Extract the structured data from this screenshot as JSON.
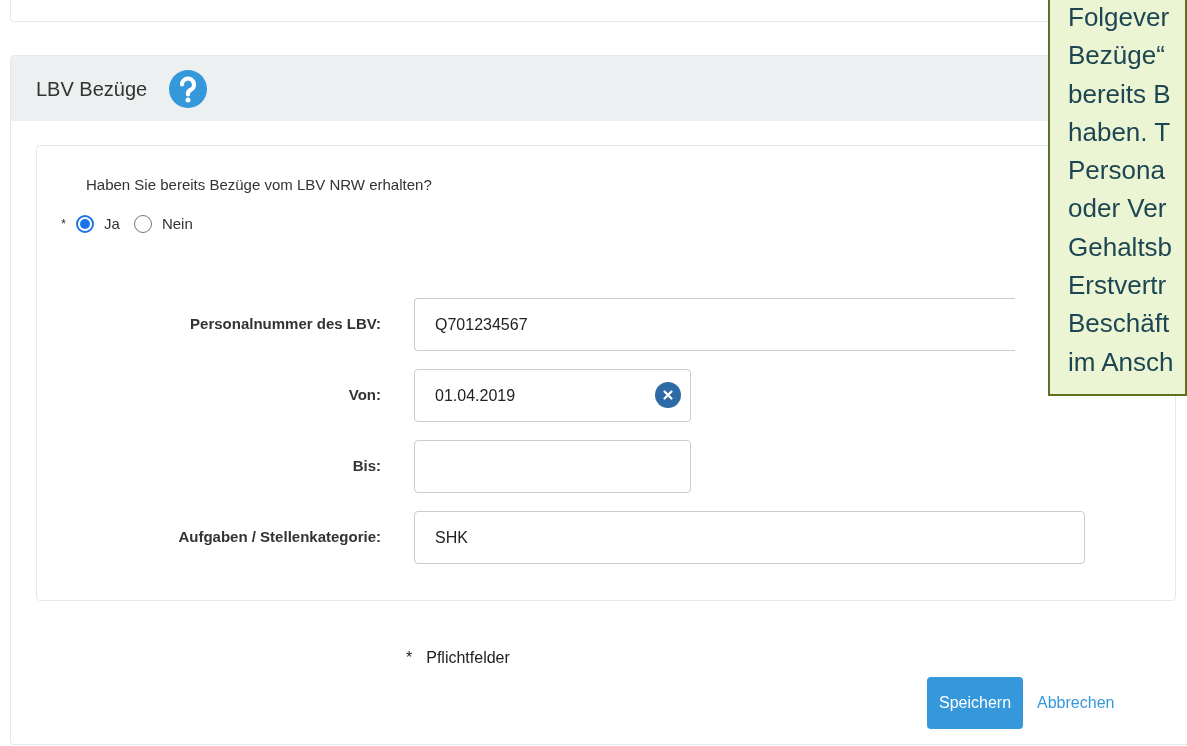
{
  "section": {
    "title": "LBV Bezüge"
  },
  "question": {
    "text": "Haben Sie bereits Bezüge vom LBV NRW erhalten?",
    "required_mark": "*",
    "options": [
      {
        "label": "Ja",
        "selected": true
      },
      {
        "label": "Nein",
        "selected": false
      }
    ]
  },
  "fields": [
    {
      "label": "Personalnummer des LBV:",
      "value": "Q701234567",
      "kind": "wide_covered"
    },
    {
      "label": "Von:",
      "value": "01.04.2019",
      "kind": "date_clearable"
    },
    {
      "label": "Bis:",
      "kind": "date"
    },
    {
      "label": "Aufgaben / Stellenkategorie:",
      "value": "SHK",
      "kind": "wide"
    }
  ],
  "footnote": {
    "mark": "*",
    "text": "Pflichtfelder"
  },
  "buttons": [
    {
      "label": "Speichern",
      "kind": "primary"
    },
    {
      "label": "Abbrechen",
      "kind": "link"
    }
  ],
  "callout": {
    "lines": [
      "Folgever",
      "Bezüge“",
      "bereits B",
      "haben. T",
      "Persona",
      "oder Ver",
      "Gehaltsb",
      "Erstvertr",
      "Beschäft",
      "im Ansch"
    ]
  }
}
